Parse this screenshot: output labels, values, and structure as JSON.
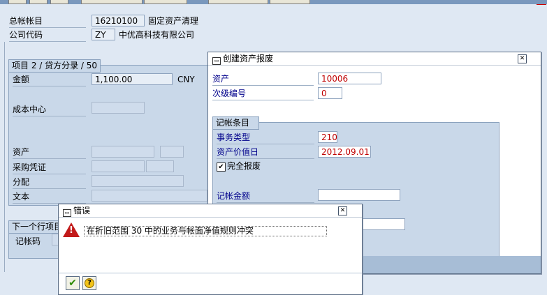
{
  "header": {
    "gl_account_label": "总帐帐目",
    "gl_account_value": "16210100",
    "gl_account_desc": "固定资产清理",
    "company_code_label": "公司代码",
    "company_code_value": "ZY",
    "company_code_desc": "中优高科技有限公司"
  },
  "item_group": {
    "title": "项目 2 / 贷方分录 / 50",
    "amount_label": "金额",
    "amount_value": "1,100.00",
    "currency": "CNY",
    "cost_center_label": "成本中心",
    "asset_label": "资产",
    "purchase_doc_label": "采购凭证",
    "assignment_label": "分配",
    "text_label": "文本"
  },
  "next_line": {
    "title": "下一个行项目",
    "posting_key_label": "记帐码"
  },
  "retire_dialog": {
    "title": "创建资产报废",
    "asset_label": "资产",
    "asset_value": "10006",
    "subnumber_label": "次级编号",
    "subnumber_value": "0",
    "posting_group_title": "记帐条目",
    "trans_type_label": "事务类型",
    "trans_type_value": "210",
    "value_date_label": "资产价值日",
    "value_date_value": "2012.09.01",
    "complete_retire_label": "完全报废",
    "complete_retire_checked": true,
    "posting_amount_label": "记帐金额"
  },
  "error_dialog": {
    "title": "错误",
    "message": "在折旧范围 30 中的业务与帐面净值规则冲突"
  },
  "colors": {
    "title_bar": "#7a98bd",
    "panel": "#c9d8e9",
    "value_red": "#c00000",
    "label_blue": "#00008b"
  }
}
